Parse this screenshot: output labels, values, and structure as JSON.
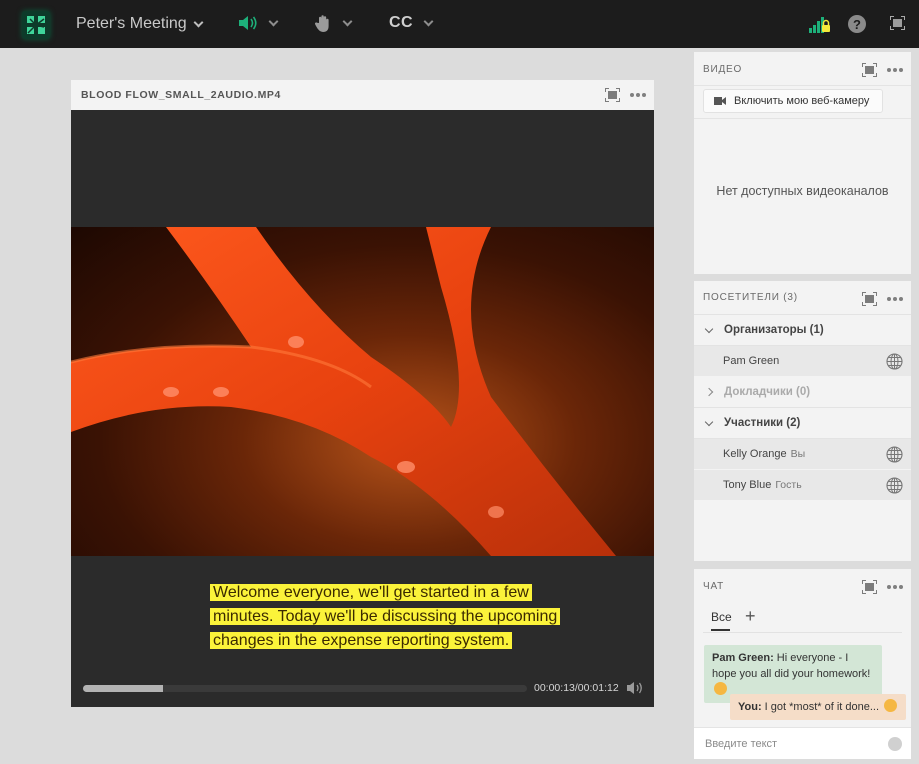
{
  "topbar": {
    "meeting_name": "Peter's Meeting",
    "audio_icon": "speaker-icon",
    "hand_icon": "raise-hand-icon",
    "cc_label": "CC",
    "connection_icon": "signal-secure-icon",
    "help_label": "?",
    "fullscreen_icon": "fullscreen-icon",
    "accent_color": "#1db07a"
  },
  "video_pod": {
    "title": "BLOOD FLOW_SMALL_2AUDIO.MP4",
    "caption": "Welcome everyone, we'll get started in a few minutes. Today we'll be discussing the upcoming changes in the expense reporting system.",
    "time_display": "00:00:13/00:01:12",
    "progress": 0.18,
    "caption_bg_color": "#fbf33a"
  },
  "video_panel": {
    "title": "ВИДЕО",
    "webcam_button": "Включить мою веб-камеру",
    "empty_message": "Нет доступных видеоканалов"
  },
  "attendees_panel": {
    "title": "ПОСЕТИТЕЛИ (3)",
    "groups": [
      {
        "label": "Организаторы (1)",
        "expanded": true,
        "users": [
          {
            "name": "Pam Green",
            "role": ""
          }
        ]
      },
      {
        "label": "Докладчики (0)",
        "expanded": false,
        "users": []
      },
      {
        "label": "Участники (2)",
        "expanded": true,
        "users": [
          {
            "name": "Kelly Orange",
            "role": "Вы"
          },
          {
            "name": "Tony Blue",
            "role": "Гость"
          }
        ]
      }
    ]
  },
  "chat_panel": {
    "title": "ЧАТ",
    "tab_all": "Все",
    "add_tab": "+",
    "messages": [
      {
        "sender": "Pam Green:",
        "text": " Hi everyone - I hope you all did your homework! "
      },
      {
        "sender": "You:",
        "text": " I got *most* of it done... "
      }
    ],
    "input_placeholder": "Введите текст"
  }
}
